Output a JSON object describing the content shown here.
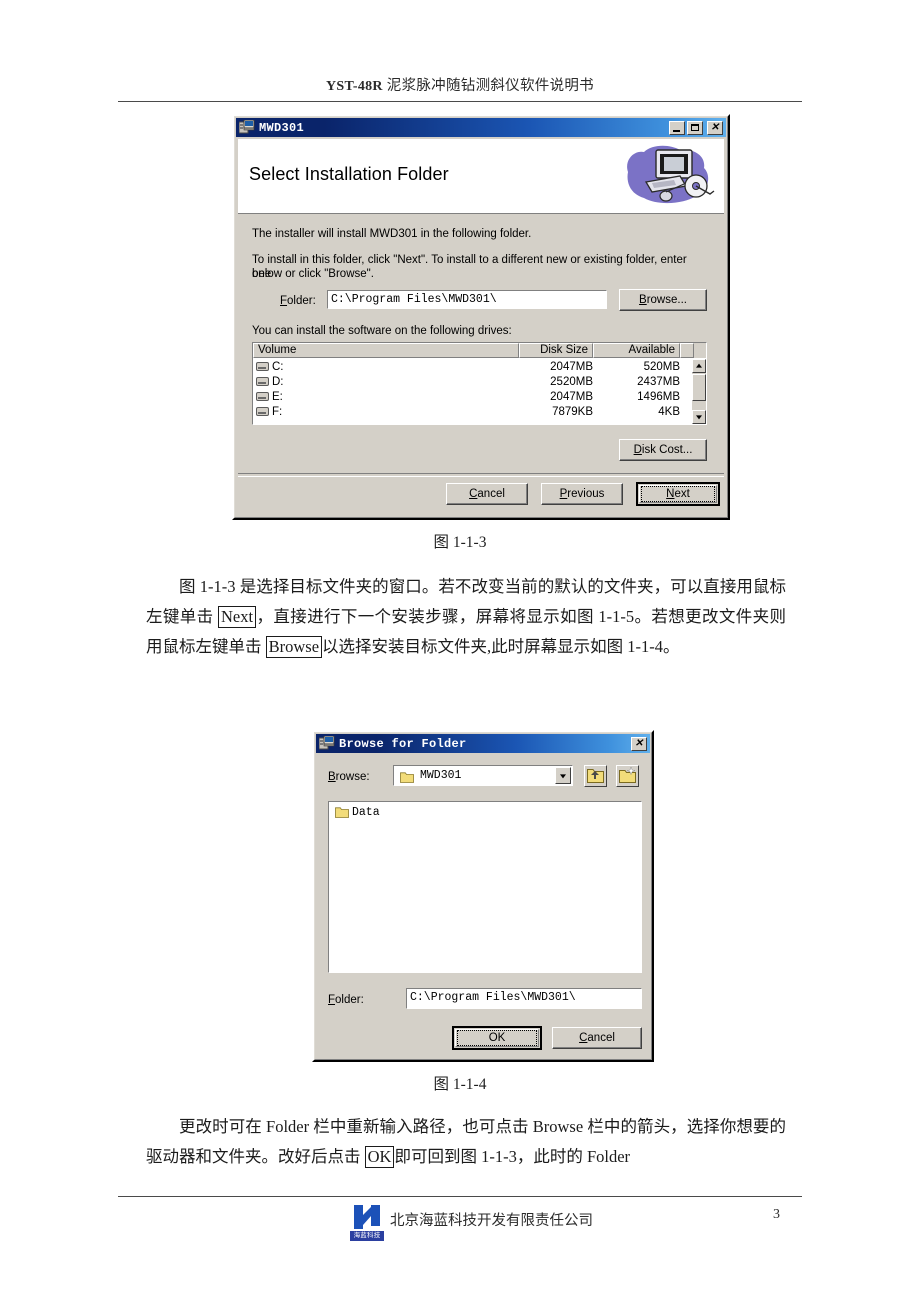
{
  "document": {
    "running_head": "YST-48R 泥浆脉冲随钻测斜仪软件说明书",
    "running_head_latin": "YST-48R",
    "running_head_cjk": " 泥浆脉冲随钻测斜仪软件说明书",
    "page_number": "3",
    "footer_company": "北京海蓝科技开发有限责任公司",
    "footer_logo_caption": "海蓝科技"
  },
  "figure_captions": {
    "fig1": "图  1-1-3",
    "fig2": "图  1-1-4"
  },
  "paragraphs": {
    "p1_part1": "图 1-1-3 是选择目标文件夹的窗口。若不改变当前的默认的文件夹，可以直接用鼠标左键单击 ",
    "p1_box1": "Next",
    "p1_part2": "，直接进行下一个安装步骤，屏幕将显示如图 1-1-5。若想更改文件夹则用鼠标左键单击 ",
    "p1_box2": "Browse",
    "p1_part3": "以选择安装目标文件夹,此时屏幕显示如图 1-1-4。",
    "p2_part1": "更改时可在 Folder 栏中重新输入路径，也可点击 Browse 栏中的箭头，选择你想要的驱动器和文件夹。改好后点击 ",
    "p2_box1": "OK",
    "p2_part2": "即可回到图 1-1-3，此时的 Folder"
  },
  "installer_dialog": {
    "title": "MWD301",
    "titlebar_icon": "installer-package-icon",
    "minimize_label": "_",
    "maximize_label": "□",
    "close_label": "✕",
    "banner_heading": "Select Installation Folder",
    "banner_art": "computer-and-cd-graphic",
    "line1": "The installer will install MWD301 in the following folder.",
    "line2": "To install in this folder, click \"Next\". To install to a different new or existing folder, enter one",
    "line3": "below or click \"Browse\".",
    "folder_label": "Folder:",
    "folder_label_accel": "F",
    "folder_label_rest": "older:",
    "folder_value": "C:\\Program Files\\MWD301\\",
    "browse_button": "Browse...",
    "browse_accel": "B",
    "browse_rest": "rowse...",
    "drives_intro": "You can install the software on the following drives:",
    "drive_table": {
      "columns": [
        "Volume",
        "Disk Size",
        "Available"
      ],
      "rows": [
        {
          "volume": "C:",
          "size": "2047MB",
          "available": "520MB"
        },
        {
          "volume": "D:",
          "size": "2520MB",
          "available": "2437MB"
        },
        {
          "volume": "E:",
          "size": "2047MB",
          "available": "1496MB"
        },
        {
          "volume": "F:",
          "size": "7879KB",
          "available": "4KB"
        }
      ]
    },
    "disk_cost_button": "Disk Cost...",
    "disk_cost_accel": "D",
    "disk_cost_rest": "isk Cost...",
    "cancel_button": "Cancel",
    "cancel_accel": "C",
    "cancel_rest": "ancel",
    "previous_button": "Previous",
    "previous_accel": "P",
    "previous_rest": "revious",
    "next_button": "Next",
    "next_accel": "N",
    "next_rest": "ext"
  },
  "browse_dialog": {
    "title": "Browse for Folder",
    "titlebar_icon": "installer-package-icon",
    "close_label": "✕",
    "browse_label": "Browse:",
    "browse_accel": "B",
    "browse_rest": "rowse:",
    "browse_value": "MWD301",
    "up_one_level_icon": "folder-up-icon",
    "new_folder_icon": "new-folder-icon",
    "tree_items": [
      "Data"
    ],
    "folder_label": "Folder:",
    "folder_accel": "F",
    "folder_rest": "older:",
    "folder_value": "C:\\Program Files\\MWD301\\",
    "ok_button": "OK",
    "cancel_button": "Cancel",
    "cancel_accel": "C",
    "cancel_rest": "ancel"
  },
  "colors": {
    "dialog_face": "#d4d0c8",
    "title_gradient_start": "#0a246a",
    "title_gradient_end": "#60b0ec",
    "field_bg": "#ffffff",
    "folder_yellow": "#f2dc7a",
    "logo_blue": "#1c51b8"
  }
}
